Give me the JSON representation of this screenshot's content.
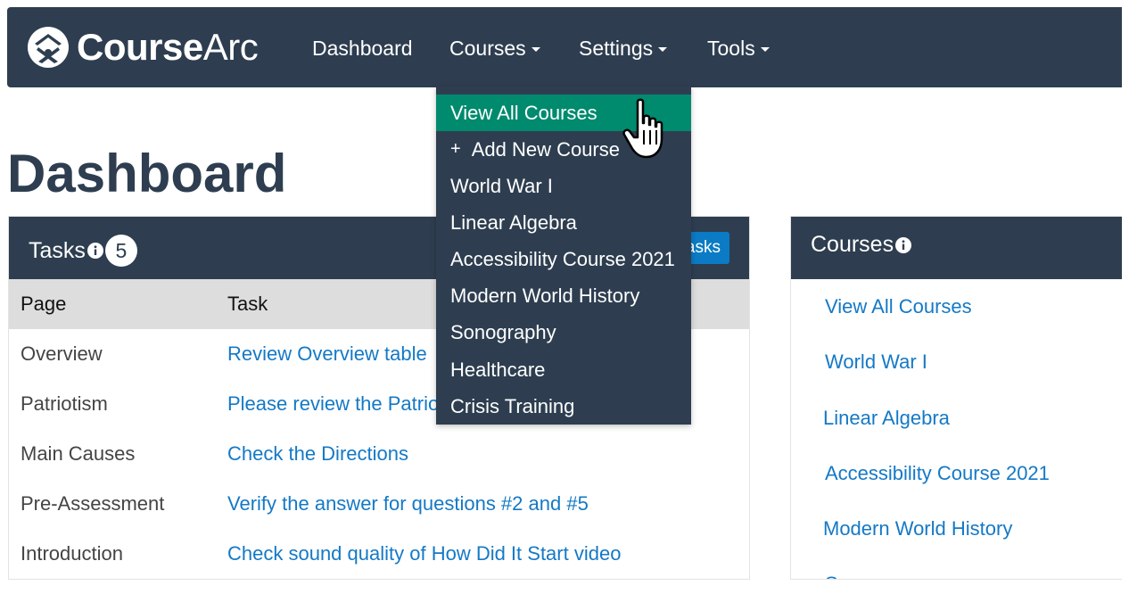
{
  "brand": {
    "name_bold": "Course",
    "name_light": "Arc"
  },
  "nav": {
    "items": [
      {
        "label": "Dashboard"
      },
      {
        "label": "Courses"
      },
      {
        "label": "Settings"
      },
      {
        "label": "Tools"
      }
    ]
  },
  "page": {
    "title": "Dashboard"
  },
  "tasks": {
    "title": "Tasks",
    "count": "5",
    "button_label": "asks",
    "columns": [
      "Page",
      "Task"
    ],
    "rows": [
      {
        "page": "Overview",
        "task": "Review Overview table"
      },
      {
        "page": "Patriotism",
        "task": "Please review the Patrio"
      },
      {
        "page": "Main Causes",
        "task": "Check the Directions"
      },
      {
        "page": "Pre-Assessment",
        "task": "Verify the answer for questions #2 and #5"
      },
      {
        "page": "Introduction",
        "task": "Check sound quality of How Did It Start video"
      }
    ]
  },
  "courses_panel": {
    "title": "Courses",
    "links": [
      "View All Courses",
      "World War I",
      "Linear Algebra",
      "Accessibility Course 2021",
      "Modern World History",
      "S"
    ]
  },
  "dropdown": {
    "items": [
      {
        "label": "View All Courses",
        "active": true
      },
      {
        "label": "Add New Course",
        "prefix": "+"
      },
      {
        "label": "World War I"
      },
      {
        "label": "Linear Algebra"
      },
      {
        "label": "Accessibility Course 2021"
      },
      {
        "label": "Modern World History"
      },
      {
        "label": "Sonography"
      },
      {
        "label": "Healthcare"
      },
      {
        "label": "Crisis Training"
      }
    ]
  },
  "colors": {
    "navbar": "#2e3e50",
    "active_item": "#008a6e",
    "link": "#1479c6",
    "button": "#0a7bc4"
  }
}
